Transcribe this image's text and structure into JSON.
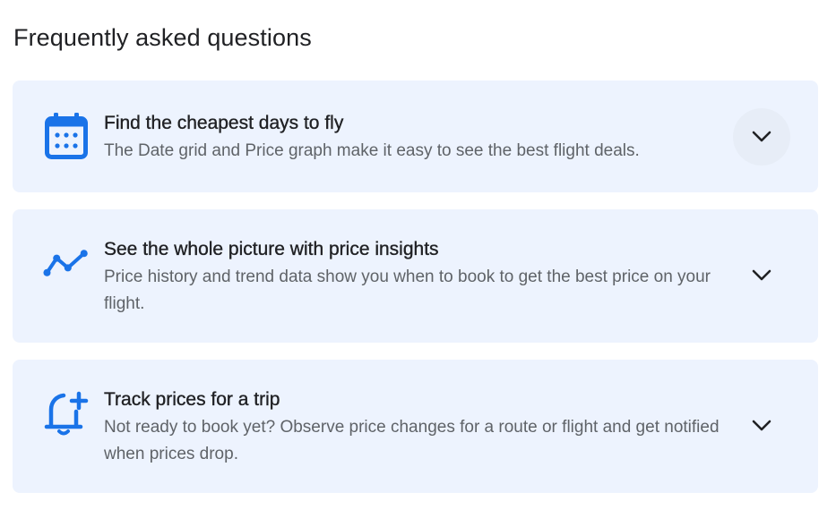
{
  "page": {
    "title": "Frequently asked questions"
  },
  "faq": [
    {
      "icon": "calendar-icon",
      "heading": "Find the cheapest days to fly",
      "description": "The Date grid and Price graph make it easy to see the best flight deals."
    },
    {
      "icon": "trend-line-icon",
      "heading": "See the whole picture with price insights",
      "description": "Price history and trend data show you when to book to get the best price on your flight."
    },
    {
      "icon": "bell-plus-icon",
      "heading": "Track prices for a trip",
      "description": "Not ready to book yet? Observe price changes for a route or flight and get notified when prices drop."
    }
  ],
  "colors": {
    "accent": "#1a73e8",
    "card_background": "#edf3fe",
    "heading": "#202124",
    "body_text": "#5f6368"
  }
}
